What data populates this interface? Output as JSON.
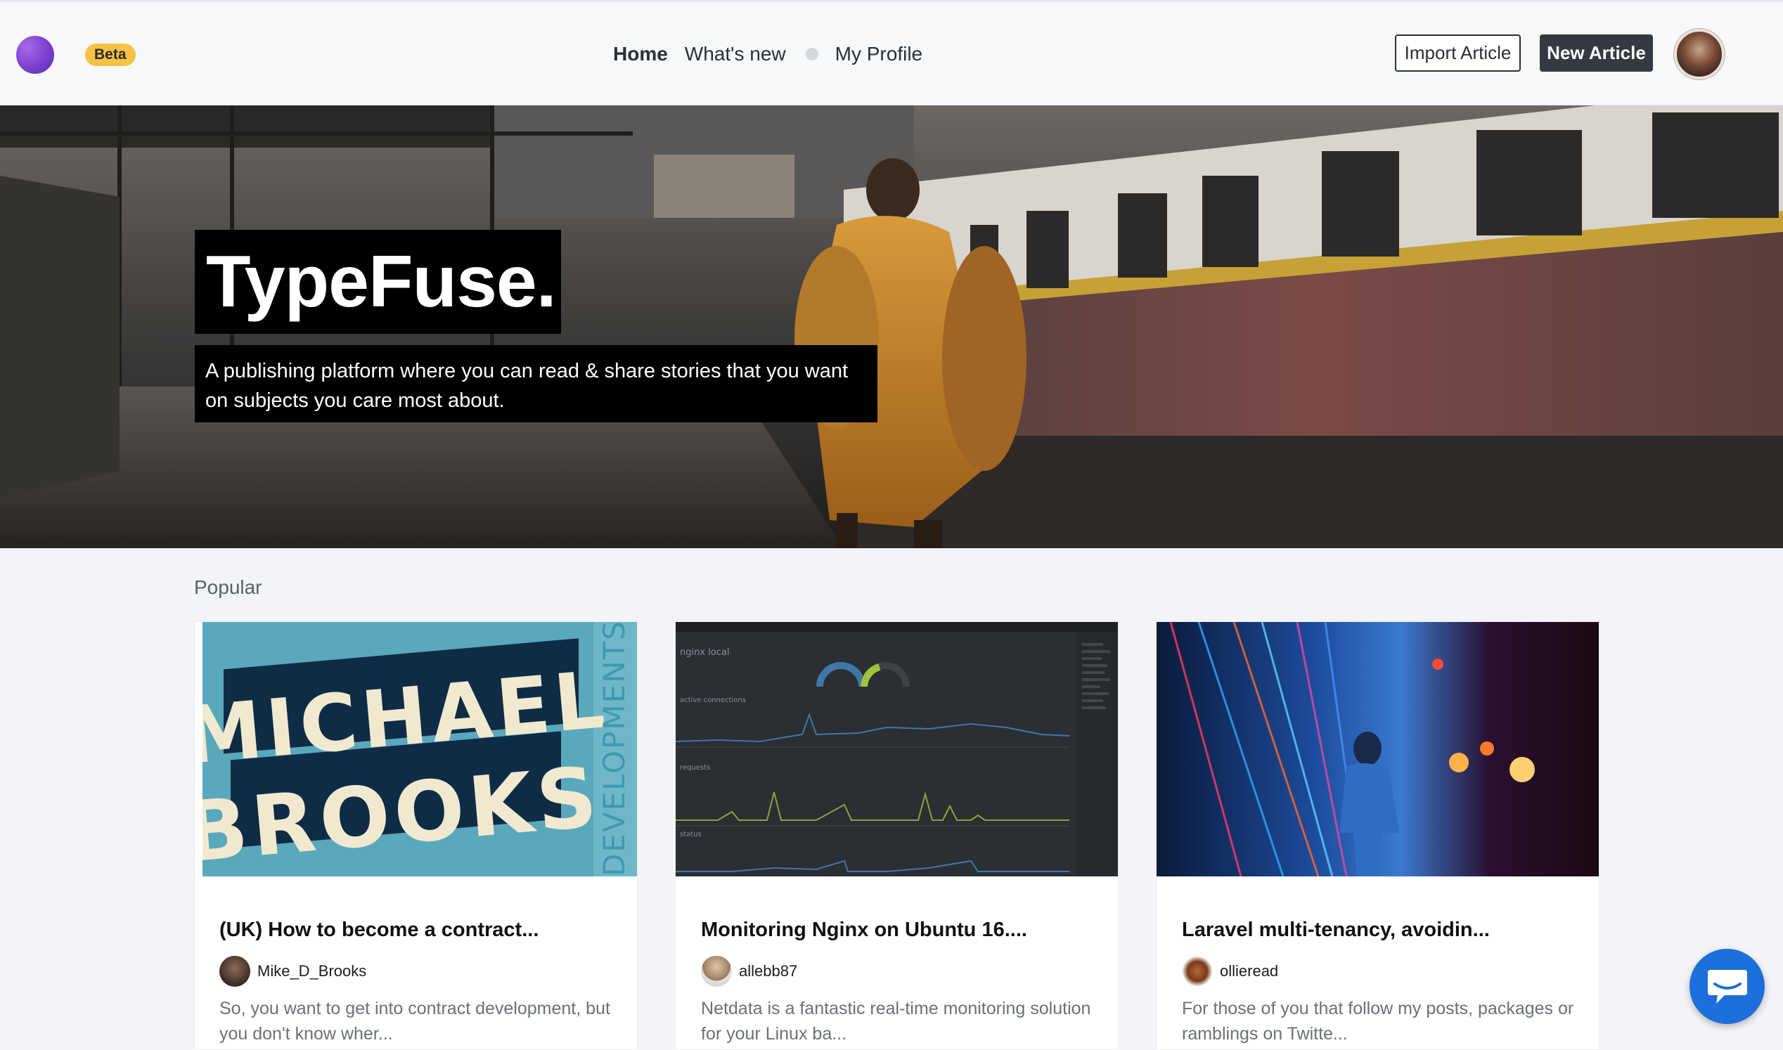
{
  "header": {
    "beta_label": "Beta",
    "nav": [
      {
        "label": "Home",
        "active": true
      },
      {
        "label": "What's new",
        "active": false
      },
      {
        "label": "My Profile",
        "active": false
      }
    ],
    "import_label": "Import Article",
    "new_label": "New Article"
  },
  "hero": {
    "title": "TypeFuse.",
    "subtitle": "A publishing platform where you can read & share stories that you want on subjects you care most about."
  },
  "popular": {
    "heading": "Popular",
    "cards": [
      {
        "image_text_main_1": "MICHAEL",
        "image_text_main_2": "BROOKS",
        "image_text_side": "DEVELOPMENTS",
        "title": "(UK) How to become a contract...",
        "author": "Mike_D_Brooks",
        "excerpt": "So, you want to get into contract development, but you don't know wher..."
      },
      {
        "image_caption_1": "nginx local",
        "image_caption_2": "active connections",
        "image_caption_3": "requests",
        "image_caption_4": "status",
        "title": "Monitoring Nginx on Ubuntu 16....",
        "author": "allebb87",
        "excerpt": "Netdata is a fantastic real-time monitoring solution for your Linux ba..."
      },
      {
        "title": "Laravel multi-tenancy, avoidin...",
        "author": "ollieread",
        "excerpt": "For those of you that follow my posts, packages or ramblings on Twitte..."
      }
    ]
  },
  "colors": {
    "accent_yellow": "#f6c243",
    "button_dark": "#343a40",
    "chat_blue": "#1d6fdc",
    "logo_purple": "#7b3fcf"
  },
  "icons": {
    "chat": "chat-icon",
    "logo": "logo-icon"
  }
}
